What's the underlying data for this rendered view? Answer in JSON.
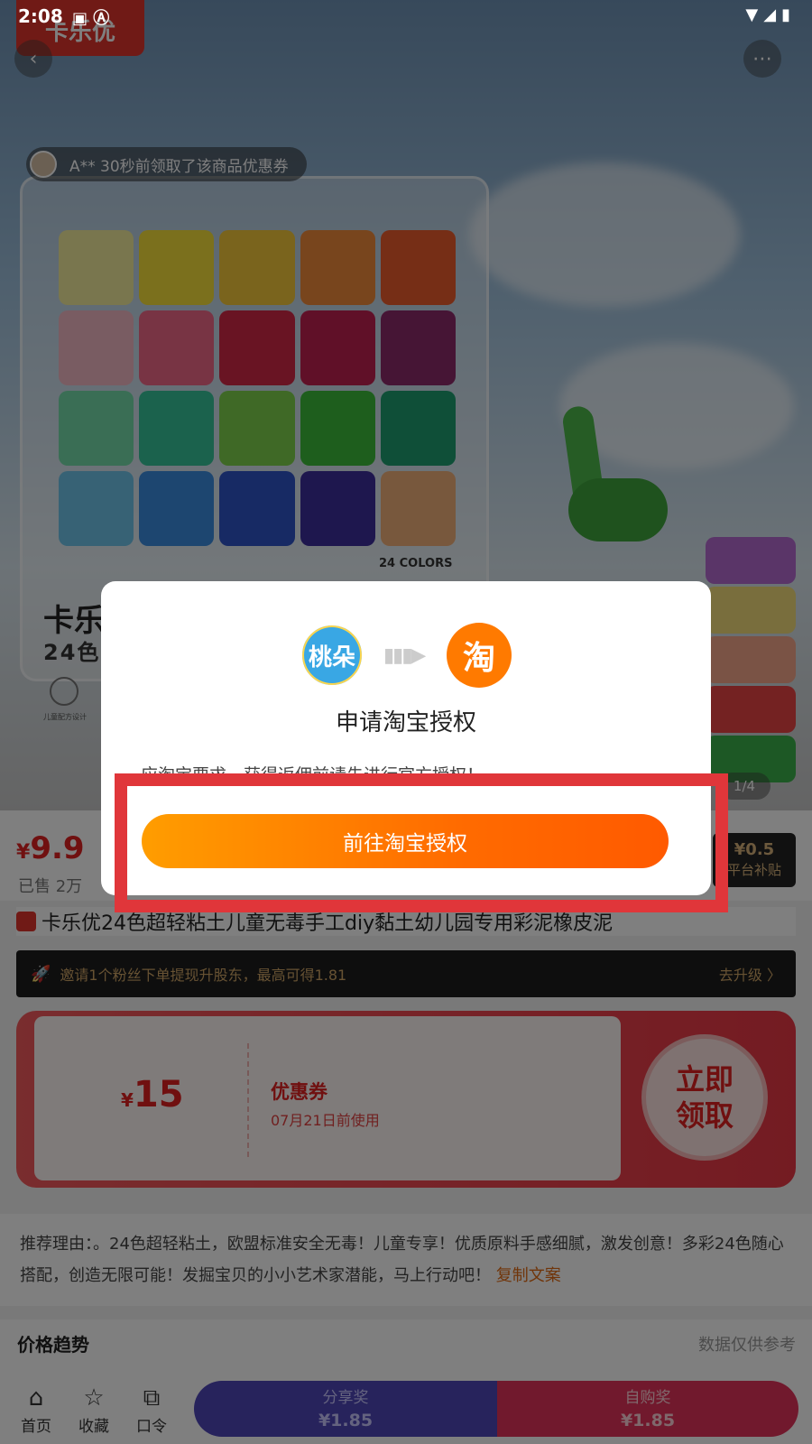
{
  "status_bar": {
    "time": "2:08"
  },
  "hero": {
    "brand_logo": "卡乐优",
    "coupon_ticker": "A** 30秒前领取了该商品优惠券",
    "product_title_partial": "卡乐",
    "product_sub_partial": "24色",
    "colors_tag": "24 COLORS",
    "badge_text": "儿童配方设计",
    "image_counter": "1/4"
  },
  "price": {
    "currency": "¥",
    "value": "9.9",
    "sold": "已售 2万"
  },
  "subsidy": {
    "amount": "¥0.5",
    "label": "平台补贴"
  },
  "product_title": "卡乐优24色超轻粘土儿童无毒手工diy黏土幼儿园专用彩泥橡皮泥",
  "upgrade_bar": {
    "text": "邀请1个粉丝下单提现升股东，最高可得1.81",
    "action": "去升级 〉"
  },
  "coupon": {
    "currency": "¥",
    "amount": "15",
    "label": "优惠券",
    "expiry": "07月21日前使用",
    "claim": "立即\n领取"
  },
  "reason": {
    "text": "推荐理由：。24色超轻粘土，欧盟标准安全无毒！儿童专享！优质原料手感细腻，激发创意！多彩24色随心搭配，创造无限可能！发掘宝贝的小小艺术家潜能，马上行动吧！",
    "copy": "复制文案"
  },
  "trend": {
    "title": "价格趋势",
    "note": "数据仅供参考"
  },
  "bottom_bar": {
    "tabs": [
      {
        "label": "首页",
        "icon": "home-icon"
      },
      {
        "label": "收藏",
        "icon": "star-icon"
      },
      {
        "label": "口令",
        "icon": "copy-icon"
      }
    ],
    "share": {
      "label": "分享奖",
      "amount": "¥1.85"
    },
    "self_buy": {
      "label": "自购奖",
      "amount": "¥1.85"
    }
  },
  "dialog": {
    "logo_left": "桃朵",
    "logo_right": "淘",
    "title": "申请淘宝授权",
    "desc": "应淘宝要求，获得返佣前请先进行官方授权！",
    "button": "前往淘宝授权"
  },
  "colors": {
    "accent_red": "#e02020",
    "taobao_orange": "#ff7a00",
    "highlight_red": "#e0363a",
    "share_purple": "#4f46b8",
    "self_pink": "#e3335a"
  }
}
